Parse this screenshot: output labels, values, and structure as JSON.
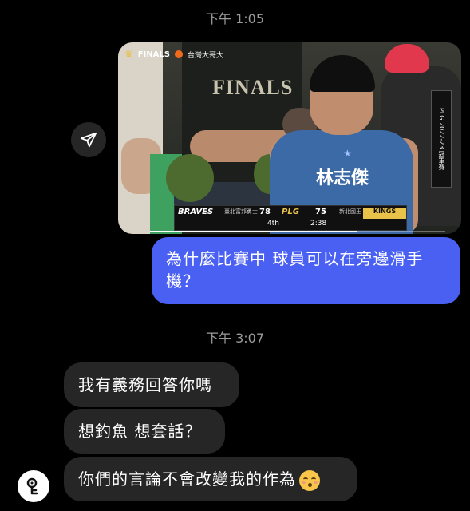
{
  "thread": {
    "timestamp_1": "下午 1:05",
    "timestamp_2": "下午 3:07"
  },
  "shared_video": {
    "broadcast_logo_text": "FINALS",
    "broadcast_sponsor": "台灣大哥大",
    "shirt_text": "FINALS",
    "jersey_name": "林志傑",
    "side_banner_text": "PLG 2022-23 冠軍賽",
    "scoreboard": {
      "team_home": "BRAVES",
      "team_home_sub": "臺北富邦勇士",
      "score_home": "78",
      "league": "PLG",
      "score_away": "75",
      "team_away_sub": "新北國王",
      "team_away": "KINGS",
      "quarter": "4th",
      "clock": "2:38"
    },
    "playback_progress": 0.7
  },
  "messages": {
    "outgoing_1": "為什麼比賽中 球員可以在旁邊滑手機？",
    "incoming_1": "我有義務回答你嗎",
    "incoming_2": "想釣魚 想套話？",
    "incoming_3": "你們的言論不會改變我的作為"
  },
  "icons": {
    "share": "send-icon",
    "avatar": "profile-avatar",
    "emoji": "kissing-face-emoji"
  },
  "colors": {
    "background": "#000000",
    "outgoing_bubble": "#4a60f3",
    "incoming_bubble": "#262626",
    "timestamp": "#9b9b9b"
  }
}
